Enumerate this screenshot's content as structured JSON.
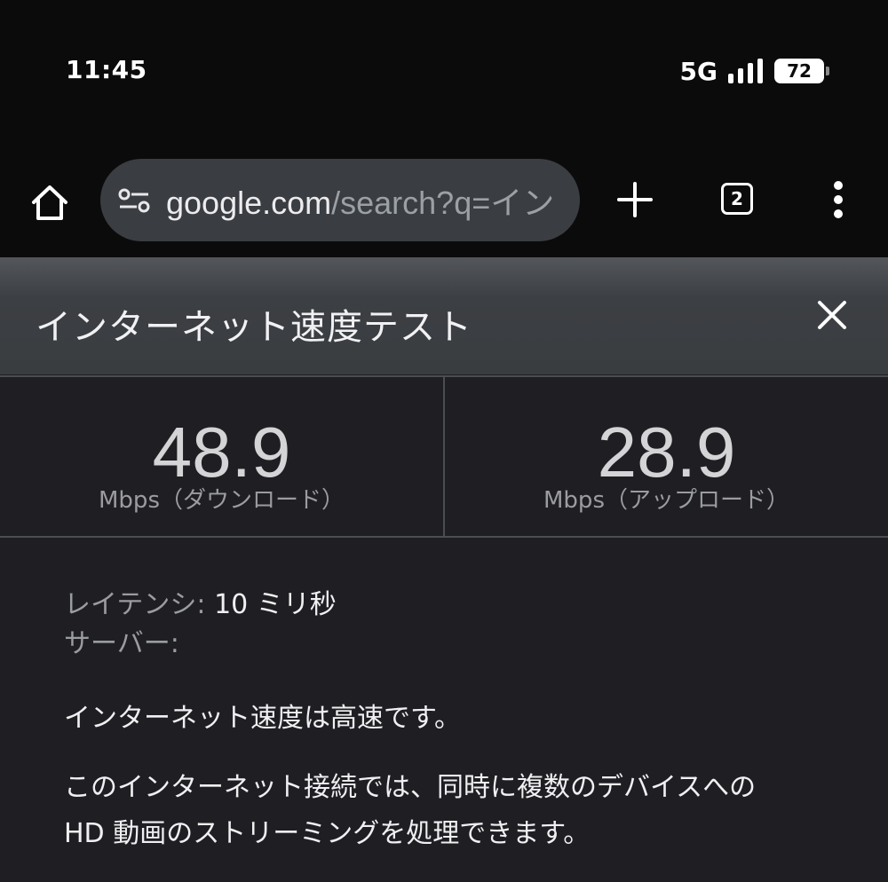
{
  "status_bar": {
    "time": "11:45",
    "network": "5G",
    "battery": "72",
    "icons": [
      "signal-icon"
    ]
  },
  "browser": {
    "url_domain": "google.com",
    "url_path": "/search?q=イン",
    "tab_count": "2",
    "icons": [
      "home-icon",
      "site-info-icon",
      "plus-icon",
      "tab-switcher-icon",
      "more-vert-icon"
    ]
  },
  "panel": {
    "title": "インターネット速度テスト",
    "close_icon": "close-icon"
  },
  "results": {
    "download": {
      "value": "48.9",
      "unit": "Mbps（ダウンロード）"
    },
    "upload": {
      "value": "28.9",
      "unit": "Mbps（アップロード）"
    }
  },
  "details": {
    "latency_label": "レイテンシ:",
    "latency_value": "10 ミリ秒",
    "server_label": "サーバー:",
    "server_value": ""
  },
  "messages": {
    "summary": "インターネット速度は高速です。",
    "line1": "このインターネット接続では、同時に複数のデバイスへの",
    "line2": "HD 動画のストリーミングを処理できます。"
  },
  "colors": {
    "background": "#1f1f23",
    "toolbar": "#0b0b0b",
    "url_bar": "#3a3d41",
    "panel_header": "#3c3f43",
    "divider": "#4a4d51"
  }
}
